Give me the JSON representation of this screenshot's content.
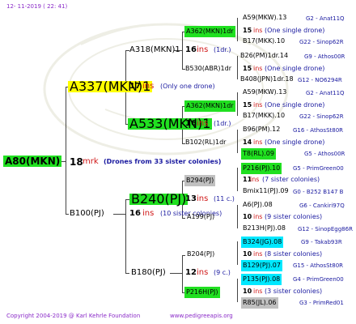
{
  "header": {
    "date": "12- 11-2019 ( 22: 41)"
  },
  "footer": {
    "copyright": "Copyright 2004-2019 @ Karl Kehrle Foundation",
    "site": "www.pedigreeapis.org"
  },
  "tree": {
    "root": "A80(MKN)",
    "root_ins": "18",
    "root_mrk": "mrk",
    "root_drones": "(Drones from 33 sister colonies)",
    "sire": "A337(MKN)1",
    "sire_ins": "17",
    "sire_ins_label": "ins",
    "sire_note": "(Only one drone)",
    "dam": "B100(PJ)",
    "dam_ins": "16",
    "dam_ins_label": "ins",
    "dam_note": "(10 sister colonies)",
    "gen3": [
      {
        "label": "A318(MKN)1",
        "ins": "16",
        "ins_label": "ins",
        "note": "(1dr.)"
      },
      {
        "label": "A533(MKN)1",
        "ins": "16",
        "ins_label": "ins",
        "note": "(1dr.)"
      },
      {
        "label": "B240(PJ)",
        "ins": "13",
        "ins_label": "ins",
        "note": "(11 c.)"
      },
      {
        "label": "B180(PJ)",
        "ins": "12",
        "ins_label": "ins",
        "note": "(9 c.)"
      }
    ],
    "gen4": [
      {
        "label": "A362(MKN)1dr",
        "ins": "15",
        "ins_label": "ins",
        "note": "(One single drone)"
      },
      {
        "label": "B530(ABR)1dr",
        "ins": "15",
        "ins_label": "ins",
        "note": "(One single drone)"
      },
      {
        "label": "A362(MKN)1dr",
        "ins": "15",
        "ins_label": "ins",
        "note": "(One single drone)"
      },
      {
        "label": "B102(RL)1dr",
        "ins": "14",
        "ins_label": "ins",
        "note": "(One single drone)"
      },
      {
        "label": "B294(PJ)",
        "ins": "11",
        "ins_label": "ins",
        "note": "(7 sister colonies)"
      },
      {
        "label": "A199(PJ)",
        "ins": "10",
        "ins_label": "ins",
        "note": "(9 sister colonies)"
      },
      {
        "label": "B204(PJ)",
        "ins": "10",
        "ins_label": "ins",
        "note": "(8 sister colonies)"
      },
      {
        "label": "P216H(PJ)",
        "ins": "10",
        "ins_label": "ins",
        "note": "(3 sister colonies)"
      }
    ],
    "gen5": [
      {
        "left": "A59(MKW).13",
        "right": "G2 - Anat11Q"
      },
      {
        "left": "B17(MKK).10",
        "right": "G22 - Sinop62R"
      },
      {
        "left": "B26(PM)1dr.14",
        "right": "G9 - Athos00R"
      },
      {
        "left": "B408(JPN)1dr.18",
        "right": "G12 - NO6294R"
      },
      {
        "left": "A59(MKW).13",
        "right": "G2 - Anat11Q"
      },
      {
        "left": "B17(MKK).10",
        "right": "G22 - Sinop62R"
      },
      {
        "left": "B96(PM).12",
        "right": "G16 - AthosSt80R"
      },
      {
        "left": "T8(RL).09",
        "right": "G5 - Athos00R"
      },
      {
        "left": "P216(PJ).10",
        "right": "G5 - PrimGreen00"
      },
      {
        "left": "Bmix11(PJ).09",
        "right": "G0 - B252 B147 B"
      },
      {
        "left": "A6(PJ).08",
        "right": "G6 - Cankiri97Q"
      },
      {
        "left": "B213H(PJ).08",
        "right": "G12 - SinopEgg86R"
      },
      {
        "left": "B324(JG).08",
        "right": "G9 - Takab93R"
      },
      {
        "left": "B129(PJ).07",
        "right": "G15 - AthosSt80R"
      },
      {
        "left": "P135(PJ).08",
        "right": "G4 - PrimGreen00"
      },
      {
        "left": "R85(JL).06",
        "right": "G3 - PrimRed01"
      }
    ]
  },
  "colors": {
    "green": "#20e020",
    "yellow": "#ffff00",
    "gray": "#c0c0c0",
    "cyan": "#00e8ff",
    "ins_red": "#d01818",
    "blue": "#1a1aa0",
    "root_green": "#20e020"
  }
}
